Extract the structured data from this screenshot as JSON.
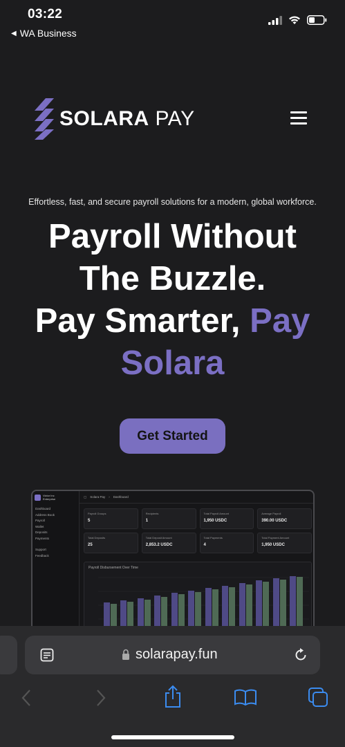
{
  "status_bar": {
    "time": "03:22",
    "back_app": "WA Business"
  },
  "header": {
    "logo_bold": "SOLARA",
    "logo_light": " PAY"
  },
  "hero": {
    "tagline": "Effortless, fast, and secure payroll solutions for a modern, global workforce.",
    "line1": "Payroll Without",
    "line2": "The Buzzle.",
    "line3_plain": "Pay Smarter, ",
    "line3_accent": "Pay",
    "line4_accent": "Solara",
    "cta_label": "Get Started"
  },
  "colors": {
    "accent": "#7b6fc4",
    "background": "#1c1c1e"
  },
  "dashboard_preview": {
    "org_name": "Victor Inc",
    "org_sub": "Enterprise",
    "breadcrumb_root": "Solara Pay",
    "breadcrumb_current": "Dashboard",
    "nav": [
      "Dashboard",
      "Address Book",
      "Payroll",
      "Wallet",
      "Deposits",
      "Payments"
    ],
    "nav_footer": [
      "Support",
      "Feedback"
    ],
    "cards": [
      {
        "title": "Payroll Groups",
        "value": "5"
      },
      {
        "title": "Recipients",
        "value": "1"
      },
      {
        "title": "Total Payroll Amount",
        "value": "1,950 USDC"
      },
      {
        "title": "Average Payroll",
        "value": "390.00 USDC"
      },
      {
        "title": "Total Deposits",
        "value": "25"
      },
      {
        "title": "Total Deposit Amount",
        "value": "2,853.2 USDC"
      },
      {
        "title": "Total Payments",
        "value": "4"
      },
      {
        "title": "Total Payment Amount",
        "value": "1,950 USDC"
      }
    ],
    "chart_title": "Payroll Disbursement Over Time"
  },
  "browser": {
    "url": "solarapay.fun",
    "icons": [
      "reader-icon",
      "lock-icon",
      "reload-icon",
      "back-icon",
      "forward-icon",
      "share-icon",
      "bookmarks-icon",
      "tabs-icon"
    ]
  }
}
